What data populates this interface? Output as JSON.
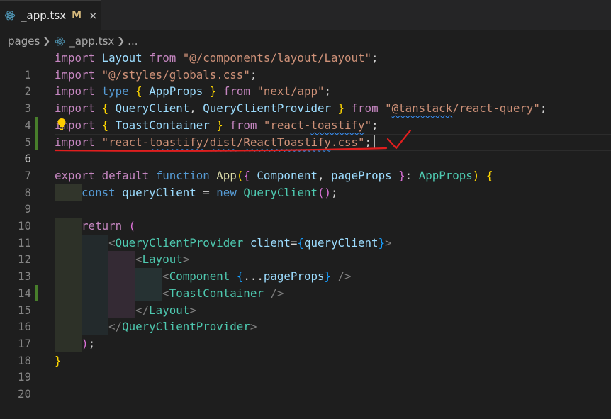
{
  "tab": {
    "filename": "_app.tsx",
    "status": "M",
    "close_glyph": "×",
    "icon": "react-icon"
  },
  "breadcrumb": {
    "folder": "pages",
    "file": "_app.tsx",
    "more": "..."
  },
  "colors": {
    "keyword_blue": "#569cd6",
    "keyword_purple": "#c586c0",
    "string": "#ce9178",
    "type": "#4ec9b0",
    "variable": "#9cdcfe",
    "function": "#dcdcaa",
    "bracket_gold": "#ffd700",
    "bracket_pink": "#da70d6",
    "bracket_blue": "#179fff",
    "annotation_red": "#e01e1e"
  },
  "editor": {
    "active_line": "6",
    "modified_lines": [
      "5",
      "6",
      "15"
    ],
    "lines": [
      {
        "n": "1",
        "code": "import Layout from \"@/components/layout/Layout\";"
      },
      {
        "n": "2",
        "code": "import \"@/styles/globals.css\";"
      },
      {
        "n": "3",
        "code": "import type { AppProps } from \"next/app\";"
      },
      {
        "n": "4",
        "code": "import { QueryClient, QueryClientProvider } from \"@tanstack/react-query\";"
      },
      {
        "n": "5",
        "code": "import { ToastContainer } from \"react-toastify\";"
      },
      {
        "n": "6",
        "code": "import \"react-toastify/dist/ReactToastify.css\";"
      },
      {
        "n": "7",
        "code": ""
      },
      {
        "n": "8",
        "code": "export default function App({ Component, pageProps }: AppProps) {"
      },
      {
        "n": "9",
        "code": "    const queryClient = new QueryClient();"
      },
      {
        "n": "10",
        "code": ""
      },
      {
        "n": "11",
        "code": "    return ("
      },
      {
        "n": "12",
        "code": "        <QueryClientProvider client={queryClient}>"
      },
      {
        "n": "13",
        "code": "            <Layout>"
      },
      {
        "n": "14",
        "code": "                <Component {...pageProps} />"
      },
      {
        "n": "15",
        "code": "                <ToastContainer />"
      },
      {
        "n": "16",
        "code": "            </Layout>"
      },
      {
        "n": "17",
        "code": "        </QueryClientProvider>"
      },
      {
        "n": "18",
        "code": "    );"
      },
      {
        "n": "19",
        "code": "}"
      },
      {
        "n": "20",
        "code": ""
      }
    ]
  }
}
